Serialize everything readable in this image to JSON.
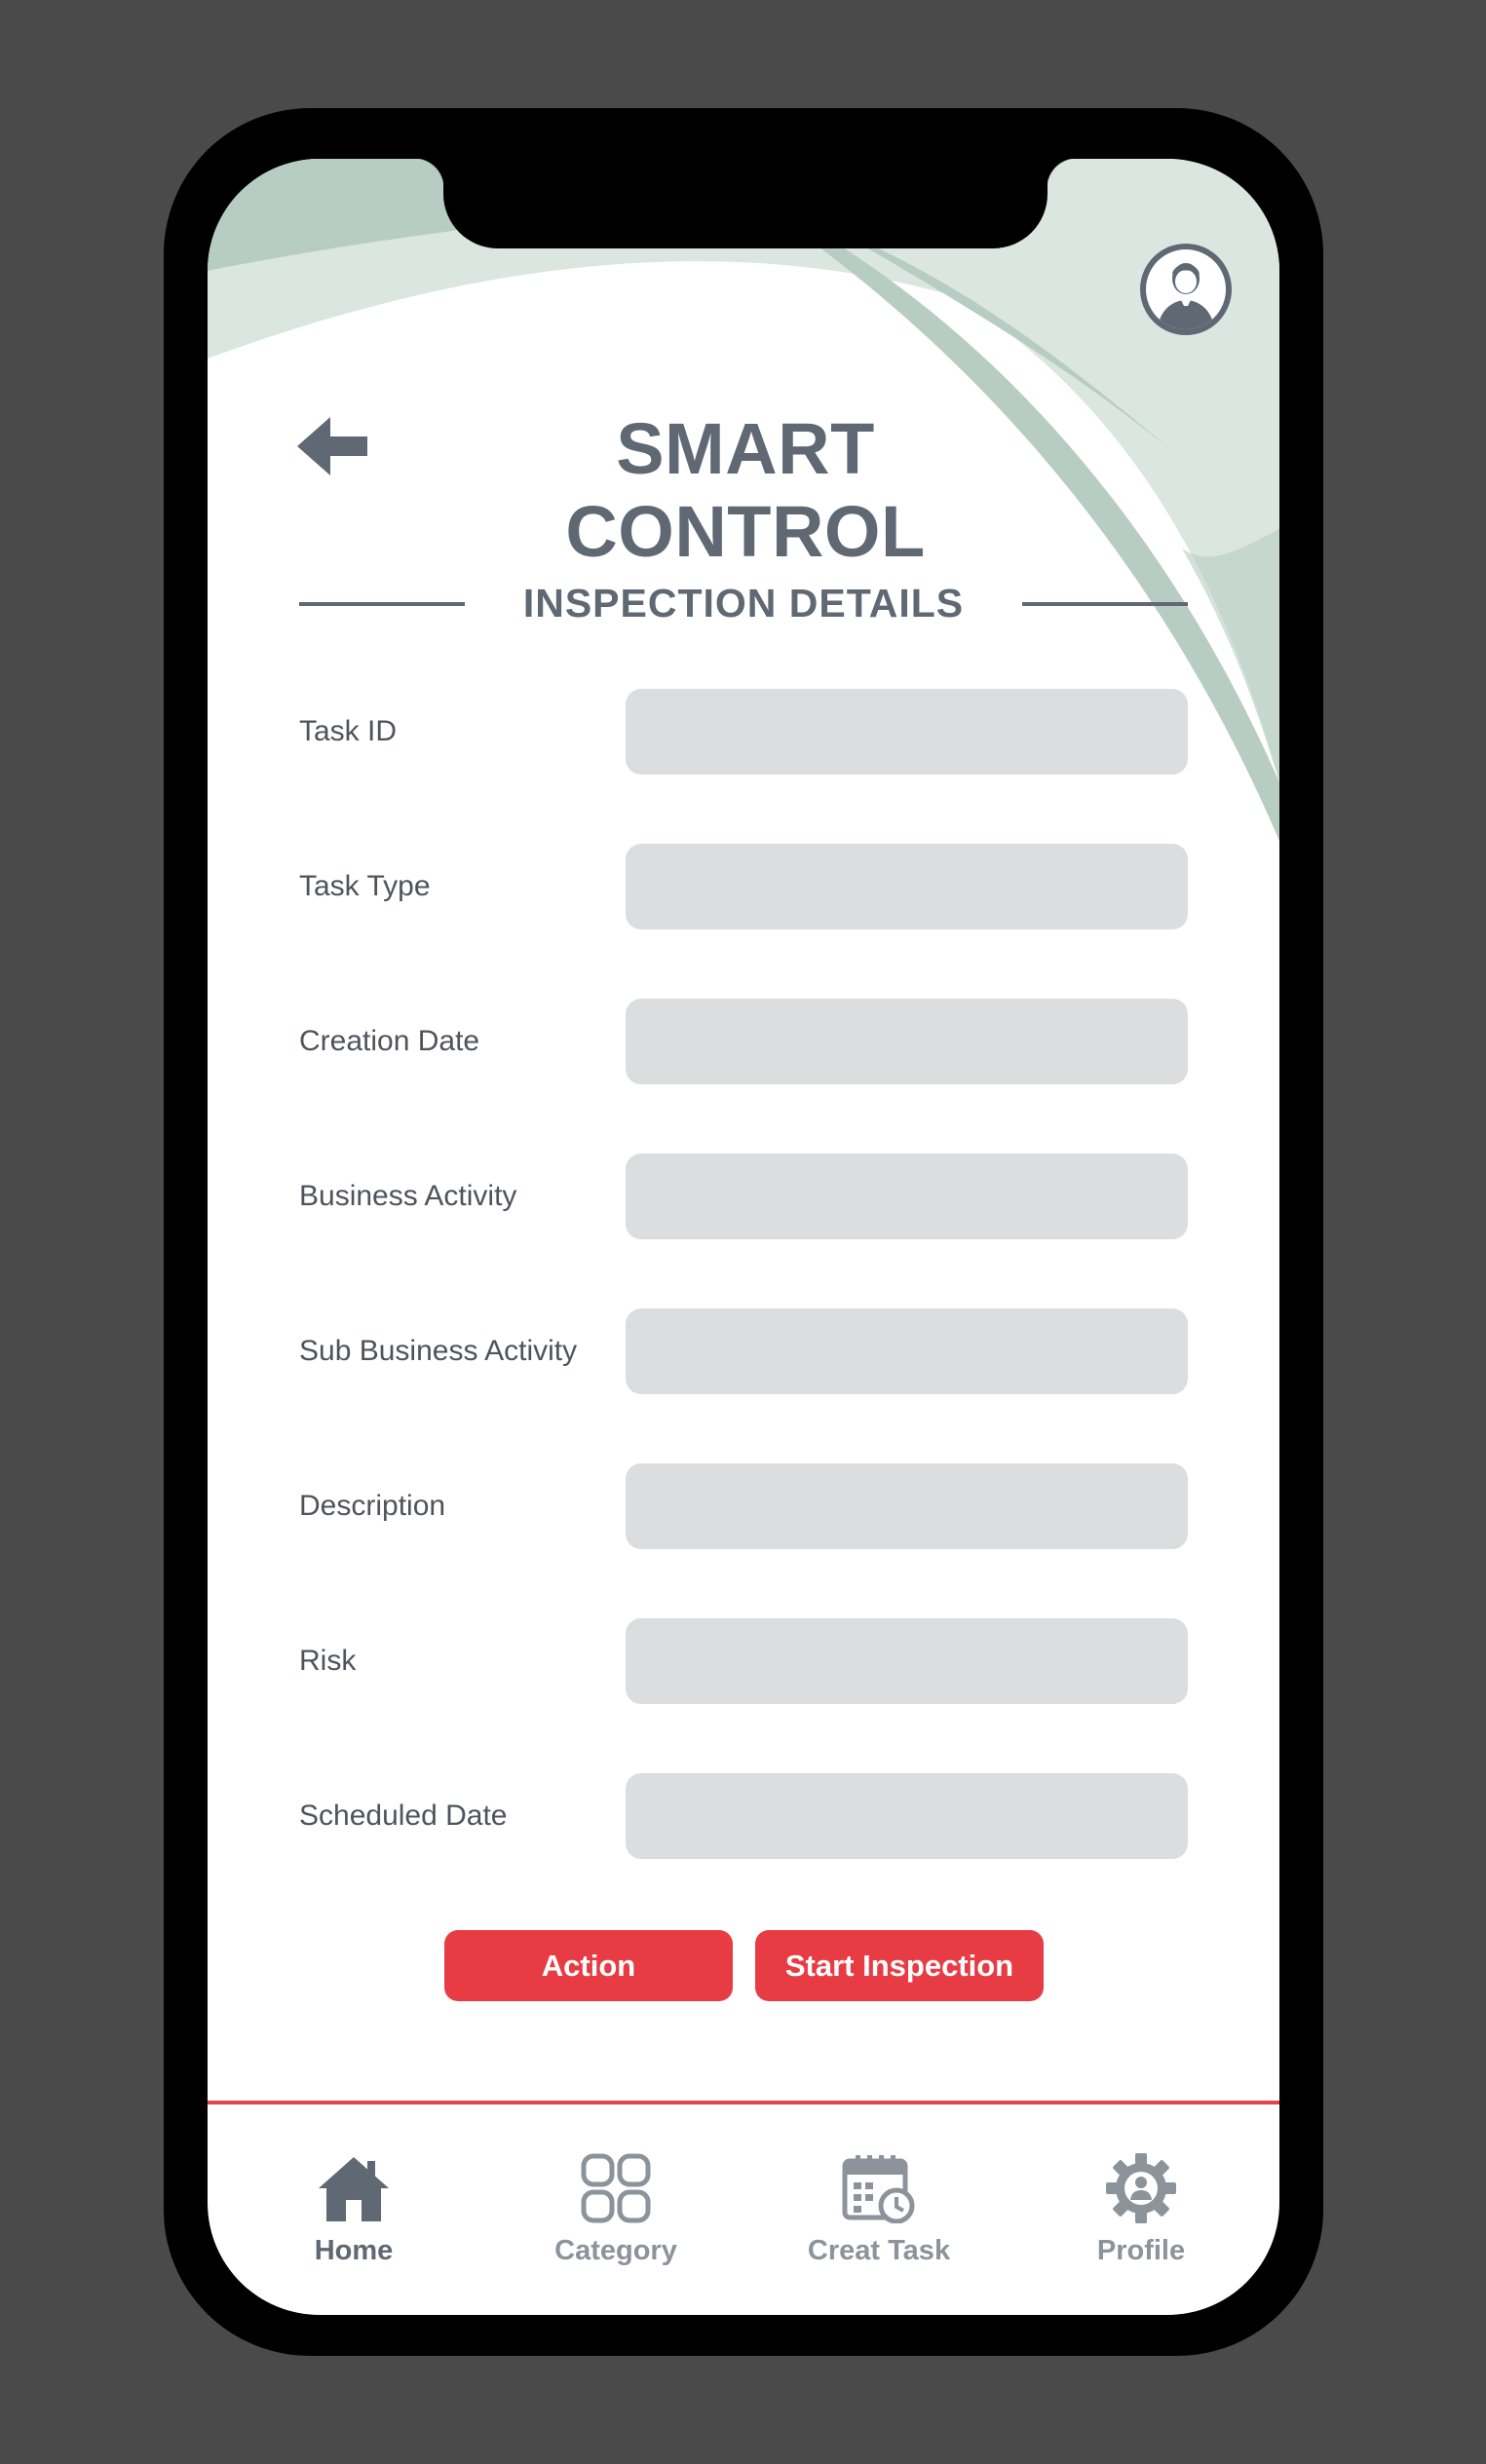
{
  "app": {
    "title": "SMART CONTROL"
  },
  "section": {
    "title": "INSPECTION DETAILS"
  },
  "fields": [
    {
      "label": "Task ID",
      "value": ""
    },
    {
      "label": "Task Type",
      "value": ""
    },
    {
      "label": "Creation Date",
      "value": ""
    },
    {
      "label": "Business Activity",
      "value": ""
    },
    {
      "label": "Sub Business Activity",
      "value": ""
    },
    {
      "label": "Description",
      "value": ""
    },
    {
      "label": "Risk",
      "value": ""
    },
    {
      "label": "Scheduled Date",
      "value": ""
    }
  ],
  "buttons": {
    "action": "Action",
    "start_inspection": "Start Inspection"
  },
  "nav": [
    {
      "label": "Home",
      "icon": "home-icon",
      "active": true
    },
    {
      "label": "Category",
      "icon": "category-icon",
      "active": false
    },
    {
      "label": "Creat Task",
      "icon": "calendar-clock-icon",
      "active": false
    },
    {
      "label": "Profile",
      "icon": "gear-user-icon",
      "active": false
    }
  ],
  "colors": {
    "accent": "#e83c45",
    "text_dark": "#5f6873",
    "input_bg": "#dcdddf",
    "deco_green": "#b7cdc3",
    "deco_light": "#dbe6e1",
    "nav_inactive": "#8c939b"
  }
}
